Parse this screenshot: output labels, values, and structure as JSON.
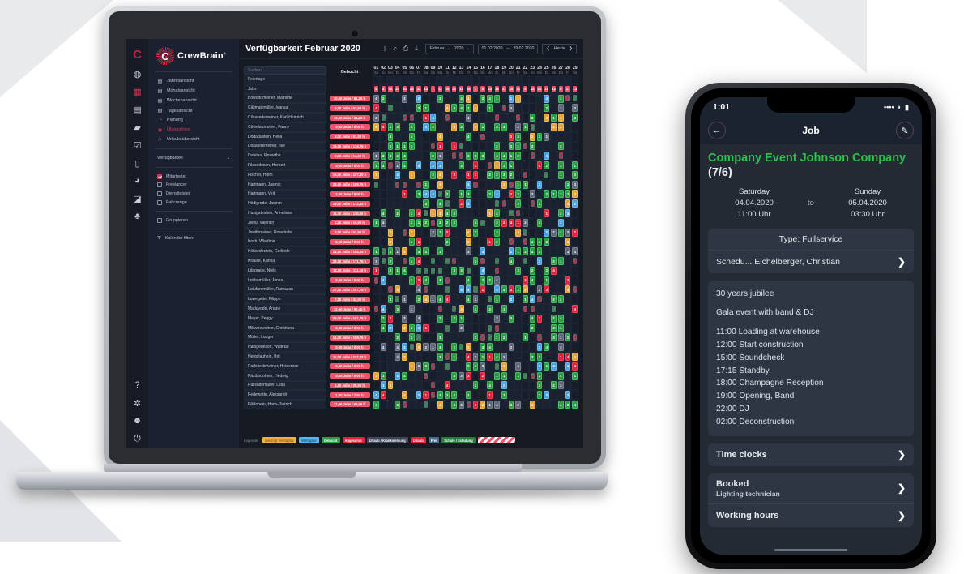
{
  "desktop": {
    "brand": {
      "name": "CrewBrain",
      "trademark": "®"
    },
    "rail_icons": [
      "logo-icon",
      "dashboard-icon",
      "calendar-icon",
      "table-icon",
      "folder-icon",
      "check-icon",
      "clipboard-icon",
      "clock-icon",
      "chart-icon",
      "people-icon"
    ],
    "rail_bottom_icons": [
      "help-icon",
      "settings-icon",
      "user-icon",
      "power-icon"
    ],
    "nav": [
      {
        "label": "Jahresansicht",
        "icon": "calendar-icon",
        "active": false
      },
      {
        "label": "Monatsansicht",
        "icon": "calendar-icon",
        "active": false
      },
      {
        "label": "Wochenansicht",
        "icon": "calendar-icon",
        "active": false
      },
      {
        "label": "Tagesansicht",
        "icon": "calendar-icon",
        "active": false
      },
      {
        "label": "Planung",
        "icon": "planning-icon",
        "active": false
      },
      {
        "label": "Übersichten",
        "icon": "eye-icon",
        "active": true
      },
      {
        "label": "Urlaubsübersicht",
        "icon": "vacation-icon",
        "active": false
      }
    ],
    "select": {
      "label": "Verfügbarkeit",
      "caret": "⌄"
    },
    "checkboxes": [
      {
        "label": "Mitarbeiter",
        "checked": true
      },
      {
        "label": "Freelancer",
        "checked": false
      },
      {
        "label": "Dienstleister",
        "checked": false
      },
      {
        "label": "Fahrzeuge",
        "checked": false
      }
    ],
    "group_checkbox": {
      "label": "Gruppieren",
      "checked": false
    },
    "filter": {
      "label": "Kalender filtern",
      "icon": "filter-icon"
    },
    "header": {
      "title": "Verfügbarkeit Februar 2020",
      "icons": [
        "plus-icon",
        "search-icon",
        "print-icon",
        "download-icon"
      ],
      "month": "Februar",
      "year": "2020",
      "date_from": "01.02.2020",
      "date_sep": "–",
      "date_to": "29.02.2020",
      "prev": "❮",
      "today": "Heute",
      "next": "❯"
    },
    "grid": {
      "search_placeholder": "Suchen...",
      "booked_header": "Gebucht",
      "days": [
        {
          "n": "01",
          "w": "Sa"
        },
        {
          "n": "02",
          "w": "So"
        },
        {
          "n": "03",
          "w": "Mo"
        },
        {
          "n": "04",
          "w": "Di"
        },
        {
          "n": "05",
          "w": "Mi"
        },
        {
          "n": "06",
          "w": "Do"
        },
        {
          "n": "07",
          "w": "Fr"
        },
        {
          "n": "08",
          "w": "Sa"
        },
        {
          "n": "09",
          "w": "So"
        },
        {
          "n": "10",
          "w": "Mo"
        },
        {
          "n": "11",
          "w": "Di"
        },
        {
          "n": "12",
          "w": "Mi"
        },
        {
          "n": "13",
          "w": "Do"
        },
        {
          "n": "14",
          "w": "Fr"
        },
        {
          "n": "15",
          "w": "Sa"
        },
        {
          "n": "16",
          "w": "So"
        },
        {
          "n": "17",
          "w": "Mo"
        },
        {
          "n": "18",
          "w": "Di"
        },
        {
          "n": "19",
          "w": "Mi"
        },
        {
          "n": "20",
          "w": "Do"
        },
        {
          "n": "21",
          "w": "Fr"
        },
        {
          "n": "22",
          "w": "Sa"
        },
        {
          "n": "23",
          "w": "So"
        },
        {
          "n": "24",
          "w": "Mo"
        },
        {
          "n": "25",
          "w": "Di"
        },
        {
          "n": "26",
          "w": "Mi"
        },
        {
          "n": "27",
          "w": "Do"
        },
        {
          "n": "28",
          "w": "Fr"
        },
        {
          "n": "29",
          "w": "Sa"
        }
      ],
      "holiday_row": {
        "label": "Feiertage"
      },
      "jobs_row": {
        "label": "Jobs",
        "counts": [
          "4",
          "4",
          "10",
          "27",
          "20",
          "28",
          "33",
          "13",
          "7",
          "12",
          "19",
          "21",
          "18",
          "16",
          "7",
          "8",
          "24",
          "19",
          "21",
          "15",
          "11",
          "9",
          "14",
          "22",
          "18",
          "12",
          "9",
          "17",
          "13"
        ]
      },
      "rows": [
        {
          "name": "Bowodomeiner, Mathilde",
          "booked": "10,00 Jobs / 61,25 h"
        },
        {
          "name": "Cälimattmüller, Ivanka",
          "booked": "9,00 Jobs / 62,50 h"
        },
        {
          "name": "Cilsasedemeiner, Karl-Heinrich",
          "booked": "16,00 Jobs / 61,25 h"
        },
        {
          "name": "Cüwelaumeiner, Fanny",
          "booked": "0,00 Jobs / 0,00 h"
        },
        {
          "name": "Dodadustein, Hella",
          "booked": "8,00 Jobs / 81,00 h"
        },
        {
          "name": "Dösaferemeiner, Ilse",
          "booked": "16,00 Jobs / 134,75 h"
        },
        {
          "name": "Dutelau, Roswitha",
          "booked": "2,00 Jobs / 14,00 h"
        },
        {
          "name": "Filasedeson, Herbert",
          "booked": "0,00 Jobs / 0,00 h"
        },
        {
          "name": "Fischer, Holm",
          "booked": "16,00 Jobs / 107,50 h"
        },
        {
          "name": "Hartmann, Jasmin",
          "booked": "23,00 Jobs / 195,75 h"
        },
        {
          "name": "Hartmann, Veit",
          "booked": "2,00 Jobs / 8,00 h"
        },
        {
          "name": "Hödigrode, Jasmin",
          "booked": "19,00 Jobs / 172,00 h"
        },
        {
          "name": "Husigatestein, Anneliese",
          "booked": "11,00 Jobs / 115,00 h"
        },
        {
          "name": "Jelifu, Valentin",
          "booked": "2,00 Jobs / 19,00 h"
        },
        {
          "name": "Jowifomeiner, Roselinde",
          "booked": "8,00 Jobs / 54,50 h"
        },
        {
          "name": "Koch, Wladimir",
          "booked": "0,00 Jobs / 0,00 h"
        },
        {
          "name": "Kötisedestein, Gerlinde",
          "booked": "21,00 Jobs / 158,25 h"
        },
        {
          "name": "Krause, Karola",
          "booked": "28,00 Jobs / 171,75 h"
        },
        {
          "name": "Litagrade, Niels",
          "booked": "12,00 Jobs / 111,10 h"
        },
        {
          "name": "Lotibamüller, Jonas",
          "booked": "0,00 Jobs / 0,00 h"
        },
        {
          "name": "Lutufaremüller, Ramazan",
          "booked": "27,00 Jobs / 167,75 h"
        },
        {
          "name": "Luwegede, Filippo",
          "booked": "7,00 Jobs / 42,00 h"
        },
        {
          "name": "Maduvode, Ariane",
          "booked": "12,00 Jobs / 90,45 h"
        },
        {
          "name": "Meyer, Peggy",
          "booked": "26,00 Jobs / 161,75 h"
        },
        {
          "name": "Milivareweiner, Christiana",
          "booked": "0,00 Jobs / 0,00 h"
        },
        {
          "name": "Müller, Ludger",
          "booked": "14,00 Jobs / 109,75 h"
        },
        {
          "name": "Nalogedeson, Waltraut",
          "booked": "0,00 Jobs / 0,00 h"
        },
        {
          "name": "Netoplauhein, Brit",
          "booked": "11,00 Jobs / 127,33 h"
        },
        {
          "name": "Padofiedeweiner, Heiderose",
          "booked": "0,00 Jobs / 0,00 h"
        },
        {
          "name": "Päsibodohein, Hedwig",
          "booked": "0,00 Jobs / 0,00 h"
        },
        {
          "name": "Palisademüller, Lidia",
          "booked": "4,00 Jobs / 28,00 h"
        },
        {
          "name": "Pedewatte, Aleksandr",
          "booked": "1,00 Jobs / 2,50 h"
        },
        {
          "name": "Pilidohein, Hans-Dietrich",
          "booked": "11,00 Jobs / 92,00 h"
        }
      ]
    },
    "legend": {
      "label": "Legende:",
      "items": [
        {
          "text": "Bedingt Verfügbar",
          "style": "amber"
        },
        {
          "text": "Verfügbar",
          "style": "blue"
        },
        {
          "text": "Gebucht",
          "style": "green"
        },
        {
          "text": "Abgesahnt",
          "style": "red"
        },
        {
          "text": "Urlaub / Krankmeldung",
          "style": "gray"
        },
        {
          "text": "Urlaub",
          "style": "vac"
        },
        {
          "text": "Frei",
          "style": "free"
        },
        {
          "text": "Schule / Schulung",
          "style": "school"
        },
        {
          "text": "",
          "style": "stripe"
        }
      ]
    }
  },
  "phone": {
    "status": {
      "time": "1:01",
      "signal": "••••",
      "wifi": "wifi-icon",
      "battery": "battery-icon"
    },
    "header": {
      "back": "←",
      "title": "Job",
      "edit": "✎"
    },
    "job": {
      "title": "Company Event Johnson Company",
      "count": "(7/6)",
      "start_day": "Saturday",
      "start_date": "04.04.2020",
      "start_time": "11:00 Uhr",
      "to": "to",
      "end_day": "Sunday",
      "end_date": "05.04.2020",
      "end_time": "03:30 Uhr"
    },
    "type_row": "Type: Fullservice",
    "scheduler_row": {
      "label": "Schedu...",
      "value": "Eichelberger, Christian",
      "chevron": "❯"
    },
    "description": {
      "heading": "30 years jubilee",
      "subheading": "Gala event with band & DJ",
      "schedule": [
        "11:00 Loading at warehouse",
        "12:00 Start construction",
        "15:00 Soundcheck",
        "17:15 Standby",
        "18:00 Champagne Reception",
        "19:00 Opening, Band",
        "22:00 DJ",
        "02:00 Deconstruction"
      ]
    },
    "rows": [
      {
        "label": "Time clocks",
        "sub": "",
        "chevron": "❯"
      },
      {
        "label": "Booked",
        "sub": "Lighting technician",
        "chevron": "❯"
      },
      {
        "label": "Working hours",
        "sub": "",
        "chevron": "❯"
      }
    ]
  }
}
